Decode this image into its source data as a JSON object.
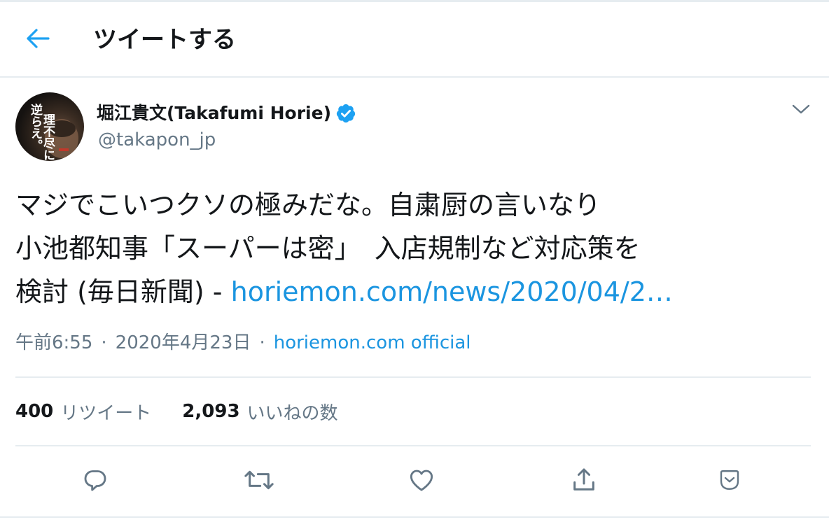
{
  "header": {
    "title": "ツイートする",
    "back_icon": "arrow-left-icon",
    "accent_color": "#1da1f2"
  },
  "author": {
    "name": "堀江貴文(Takafumi Horie)",
    "handle": "@takapon_jp",
    "verified": true,
    "avatar_text_1": "理不尽に",
    "avatar_text_2": "逆らえ。"
  },
  "tweet": {
    "line1": "マジでこいつクソの極みだな。自粛厨の言いなり",
    "line2": "小池都知事「スーパーは密」　入店規制など対応策を",
    "line3_prefix": "検討 (毎日新聞) - ",
    "link_text": "horiemon.com/news/2020/04/2…",
    "link_color": "#1b95e0"
  },
  "meta": {
    "time": "午前6:55",
    "separator": "·",
    "date": "2020年4月23日",
    "source": "horiemon.com official"
  },
  "stats": {
    "retweets_count": "400",
    "retweets_label": "リツイート",
    "likes_count": "2,093",
    "likes_label": "いいねの数"
  },
  "actions": [
    {
      "name": "reply",
      "icon": "reply-icon"
    },
    {
      "name": "retweet",
      "icon": "retweet-icon"
    },
    {
      "name": "like",
      "icon": "heart-icon"
    },
    {
      "name": "share",
      "icon": "share-icon"
    },
    {
      "name": "more",
      "icon": "chevron-down-box-icon"
    }
  ],
  "colors": {
    "text_primary": "#14171a",
    "text_secondary": "#657786",
    "border": "#e6ecf0",
    "verified_badge": "#1da1f2"
  }
}
